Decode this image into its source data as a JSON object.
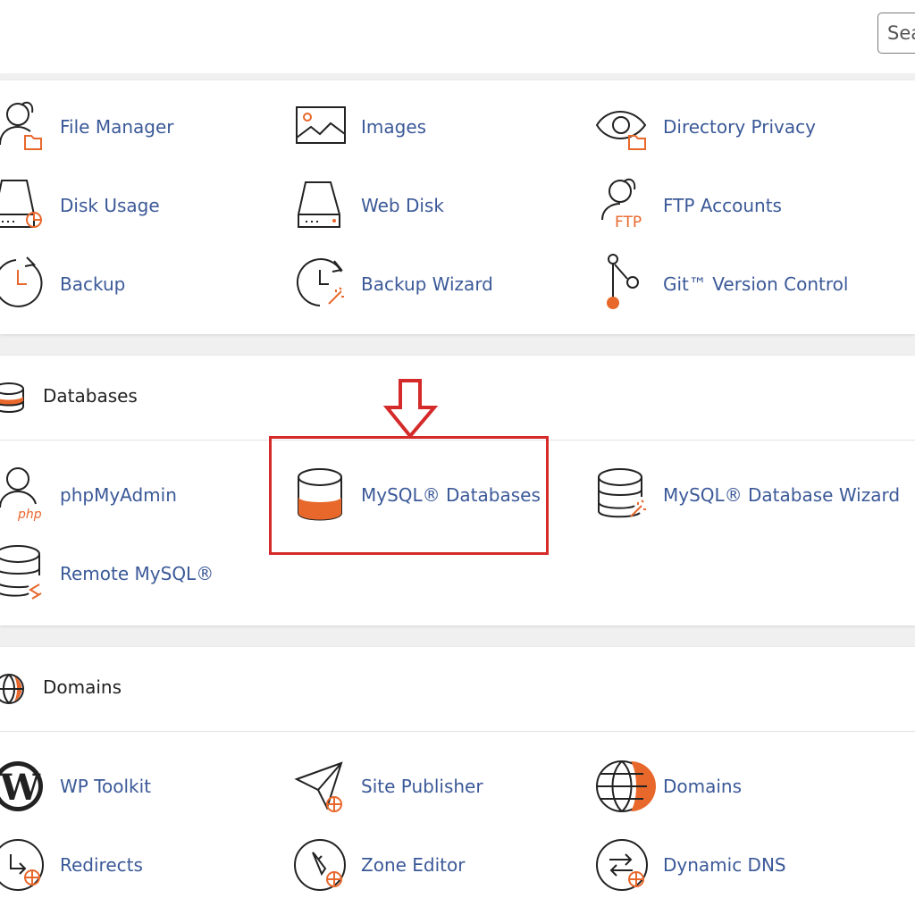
{
  "search": {
    "placeholder": "Sea"
  },
  "files": {
    "items": [
      {
        "label": "File Manager",
        "icon": "file-manager-icon"
      },
      {
        "label": "Images",
        "icon": "images-icon"
      },
      {
        "label": "Directory Privacy",
        "icon": "directory-privacy-icon"
      },
      {
        "label": "Disk Usage",
        "icon": "disk-usage-icon"
      },
      {
        "label": "Web Disk",
        "icon": "web-disk-icon"
      },
      {
        "label": "FTP Accounts",
        "icon": "ftp-accounts-icon"
      },
      {
        "label": "Backup",
        "icon": "backup-icon"
      },
      {
        "label": "Backup Wizard",
        "icon": "backup-wizard-icon"
      },
      {
        "label": "Git™ Version Control",
        "icon": "git-version-control-icon"
      }
    ]
  },
  "databases": {
    "title": "Databases",
    "items": [
      {
        "label": "phpMyAdmin",
        "icon": "phpmyadmin-icon"
      },
      {
        "label": "MySQL® Databases",
        "icon": "mysql-databases-icon"
      },
      {
        "label": "MySQL® Database Wizard",
        "icon": "mysql-database-wizard-icon"
      },
      {
        "label": "Remote MySQL®",
        "icon": "remote-mysql-icon"
      }
    ]
  },
  "domains": {
    "title": "Domains",
    "items": [
      {
        "label": "WP Toolkit",
        "icon": "wordpress-icon"
      },
      {
        "label": "Site Publisher",
        "icon": "site-publisher-icon"
      },
      {
        "label": "Domains",
        "icon": "globe-icon"
      },
      {
        "label": "Redirects",
        "icon": "redirects-icon"
      },
      {
        "label": "Zone Editor",
        "icon": "zone-editor-icon"
      },
      {
        "label": "Dynamic DNS",
        "icon": "dynamic-dns-icon"
      }
    ]
  },
  "colors": {
    "accent": "#e8672b",
    "link": "#3b5998",
    "highlight": "#d52a2a"
  }
}
